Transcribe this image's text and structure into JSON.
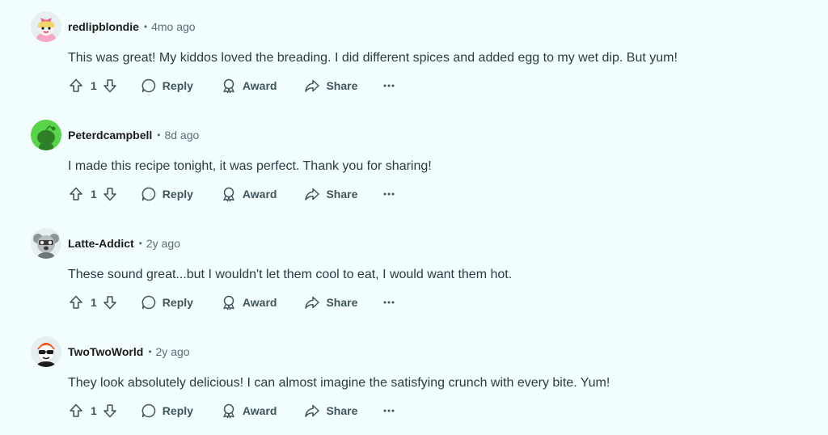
{
  "comments": [
    {
      "username": "redlipblondie",
      "separator": "•",
      "time": "4mo ago",
      "body": "This was great! My kiddos loved the breading. I did different spices and added egg to my wet dip. But yum!",
      "votes": "1",
      "avatar_icon": "avatar-pink-bow",
      "avatar_color": "#f7a6c6"
    },
    {
      "username": "Peterdcampbell",
      "separator": "•",
      "time": "8d ago",
      "body": "I made this recipe tonight, it was perfect. Thank you for sharing!",
      "votes": "1",
      "avatar_icon": "avatar-green-snoo",
      "avatar_color": "#57d448"
    },
    {
      "username": "Latte-Addict",
      "separator": "•",
      "time": "2y ago",
      "body": "These sound great...but I wouldn't let them cool to eat, I would want them hot.",
      "votes": "1",
      "avatar_icon": "avatar-koala",
      "avatar_color": "#c9cdd0"
    },
    {
      "username": "TwoTwoWorld",
      "separator": "•",
      "time": "2y ago",
      "body": "They look absolutely delicious! I can almost imagine the satisfying crunch with every bite. Yum!",
      "votes": "1",
      "avatar_icon": "avatar-sunglasses-snoo",
      "avatar_color": "#ff4500"
    }
  ],
  "actions": {
    "reply_label": "Reply",
    "award_label": "Award",
    "share_label": "Share"
  },
  "icons": [
    "upvote-icon",
    "downvote-icon",
    "reply-icon",
    "award-icon",
    "share-icon",
    "more-icon"
  ],
  "colors": {
    "background": "#f2fdfd",
    "text": "#2a3c42",
    "muted": "#576f76",
    "action": "#3f565c"
  }
}
